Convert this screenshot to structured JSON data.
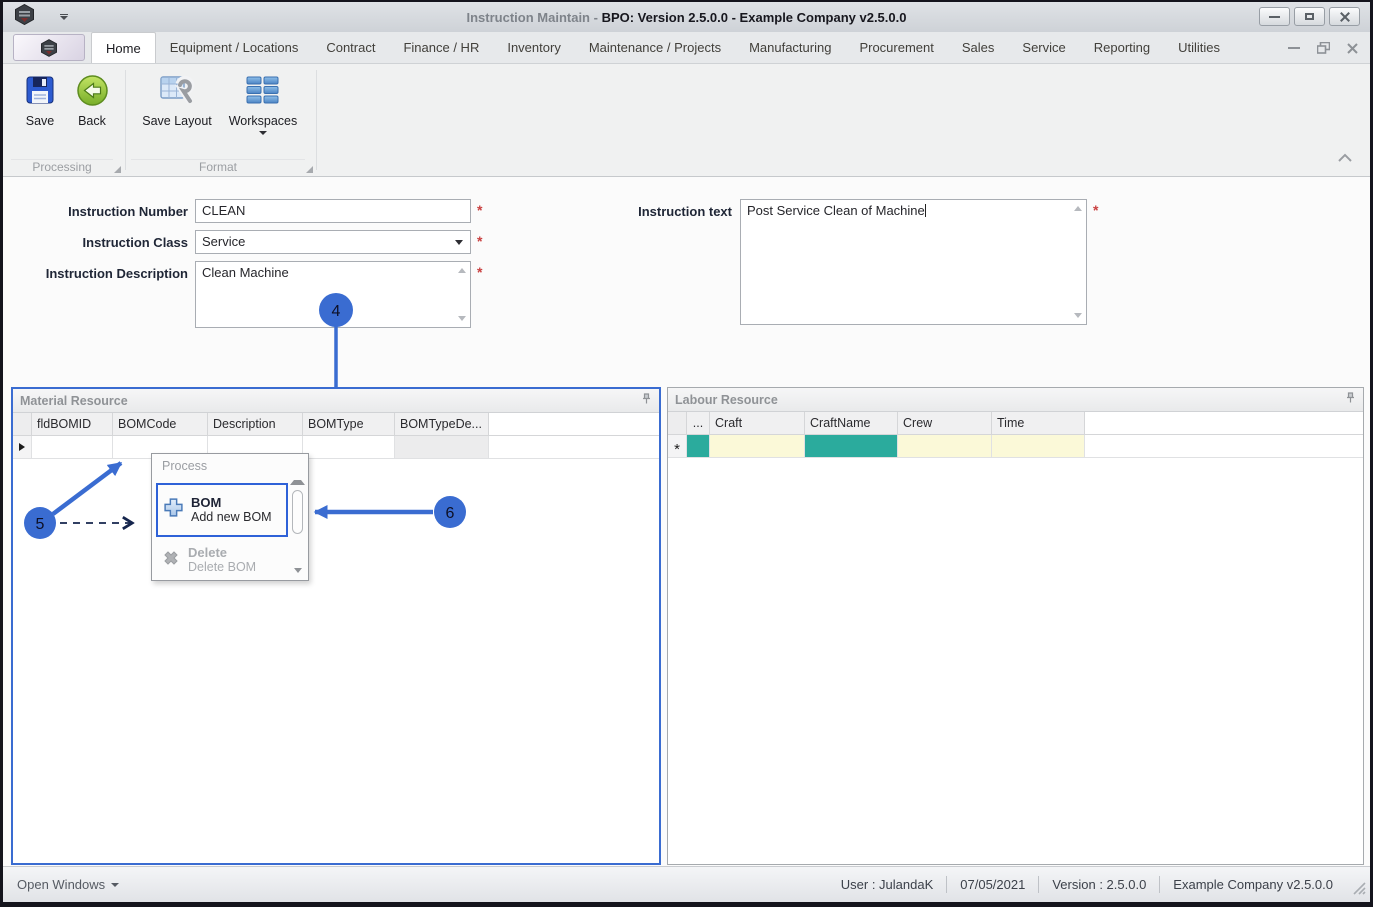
{
  "titlebar": {
    "title_app": "Instruction Maintain - ",
    "title_rest": "BPO: Version 2.5.0.0 - Example Company v2.5.0.0"
  },
  "tabs": {
    "active": "Home",
    "items": [
      "Home",
      "Equipment / Locations",
      "Contract",
      "Finance / HR",
      "Inventory",
      "Maintenance / Projects",
      "Manufacturing",
      "Procurement",
      "Sales",
      "Service",
      "Reporting",
      "Utilities"
    ]
  },
  "ribbon": {
    "groups": [
      {
        "label": "Processing",
        "buttons": [
          {
            "label": "Save",
            "icon": "floppy-disk"
          },
          {
            "label": "Back",
            "icon": "green-back-arrow"
          }
        ]
      },
      {
        "label": "Format",
        "buttons": [
          {
            "label": "Save Layout",
            "icon": "table-wrench"
          },
          {
            "label": "Workspaces",
            "icon": "blue-tile-grid",
            "has_dropdown": true
          }
        ]
      }
    ]
  },
  "form": {
    "instruction_number": {
      "label": "Instruction Number",
      "value": "CLEAN",
      "required": "*"
    },
    "instruction_class": {
      "label": "Instruction Class",
      "value": "Service",
      "required": "*"
    },
    "instruction_description": {
      "label": "Instruction Description",
      "value": "Clean Machine",
      "required": "*"
    },
    "instruction_text": {
      "label": "Instruction text",
      "value": "Post Service Clean of Machine",
      "required": "*"
    }
  },
  "material_panel": {
    "title": "Material Resource",
    "columns": [
      "fldBOMID",
      "BOMCode",
      "Description",
      "BOMType",
      "BOMTypeDe..."
    ]
  },
  "labour_panel": {
    "title": "Labour Resource",
    "columns": [
      "...",
      "Craft",
      "CraftName",
      "Crew",
      "Time"
    ],
    "new_row_marker": "*"
  },
  "context_menu": {
    "header": "Process",
    "items": [
      {
        "title": "BOM",
        "subtitle": "Add new BOM",
        "icon": "blue-plus",
        "enabled": true,
        "highlighted": true
      },
      {
        "title": "Delete",
        "subtitle": "Delete BOM",
        "icon": "gray-x",
        "enabled": false
      }
    ]
  },
  "callouts": {
    "c4": "4",
    "c5": "5",
    "c6": "6"
  },
  "statusbar": {
    "open_windows": "Open Windows",
    "user": "User : JulandaK",
    "date": "07/05/2021",
    "version": "Version : 2.5.0.0",
    "company": "Example Company v2.5.0.0"
  },
  "colors": {
    "accent_blue": "#3a6cd1",
    "selection_border_blue": "#2f62d8",
    "teal_cell": "#2bab9d",
    "pale_yellow_cell": "#fbf9d8",
    "required_red": "#c94040"
  }
}
